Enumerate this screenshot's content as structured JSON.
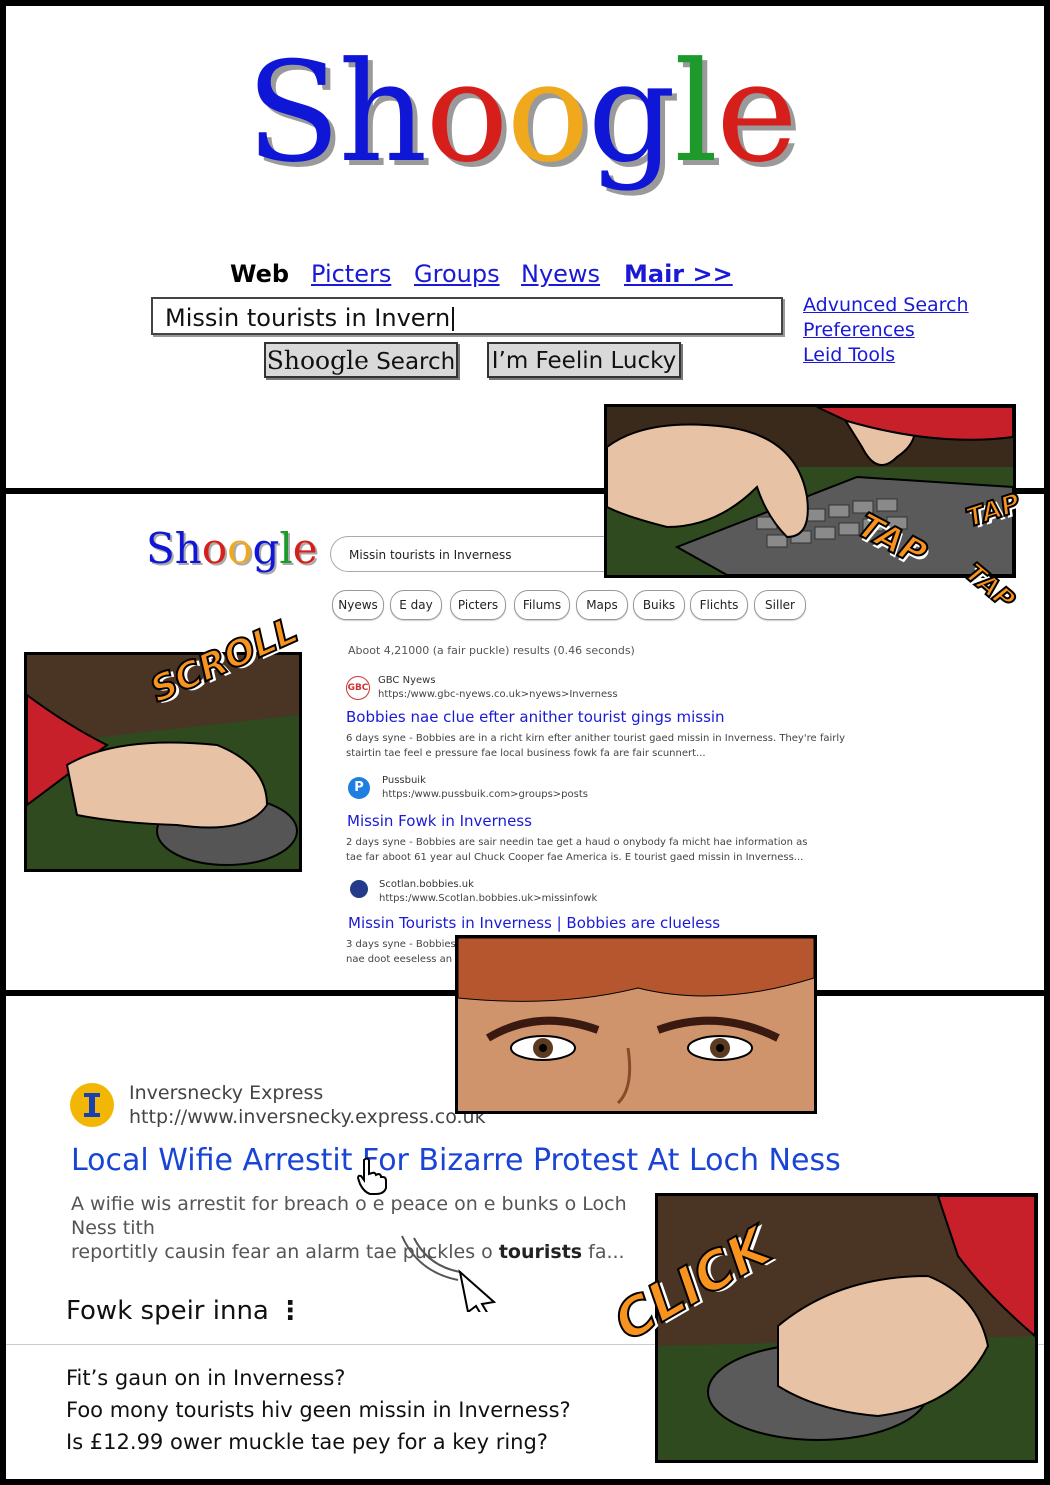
{
  "logo": {
    "letters": [
      {
        "ch": "S",
        "color": "blue"
      },
      {
        "ch": "h",
        "color": "blue"
      },
      {
        "ch": "o",
        "color": "red"
      },
      {
        "ch": "o",
        "color": "yellow"
      },
      {
        "ch": "g",
        "color": "blue"
      },
      {
        "ch": "l",
        "color": "green"
      },
      {
        "ch": "e",
        "color": "red"
      }
    ]
  },
  "nav": {
    "web": "Web",
    "picters": "Picters",
    "groups": "Groups",
    "nyews": "Nyews",
    "mair": "Mair >>"
  },
  "search": {
    "query_typing": "Missin tourists in Invern",
    "button_search_brand": "Shoogle",
    "button_search_label": "Search",
    "button_lucky": "I’m Feelin Lucky"
  },
  "side_links": {
    "advanced": "Advunced Search",
    "preferences": "Preferences",
    "tools": "Leid Tools"
  },
  "results_page": {
    "logo": "Shoogle",
    "query": "Missin tourists in Inverness",
    "chips": [
      "Nyews",
      "E day",
      "Picters",
      "Filums",
      "Maps",
      "Buiks",
      "Flichts",
      "Siller"
    ],
    "stats": "Aboot 4,21000 (a fair puckle) results (0.46 seconds)",
    "results": [
      {
        "icon_text": "GBC",
        "site": "GBC Nyews",
        "url": "https:/www.gbc-nyews.co.uk>nyews>Inverness",
        "title": "Bobbies nae clue efter anither tourist gings missin",
        "snippet1": "6 days syne - Bobbies are in a richt kirn efter anither tourist gaed missin in Inverness. They're fairly",
        "snippet2": "stairtin tae feel e pressure fae local business fowk fa are fair scunnert..."
      },
      {
        "icon_text": "P",
        "site": "Pussbuik",
        "url": "https:/www.pussbuik.com>groups>posts",
        "title": "Missin Fowk in Inverness",
        "snippet1": "2 days syne - Bobbies are sair needin tae get a haud o onybody fa micht hae information as",
        "snippet2": "tae far aboot 61 year aul Chuck Cooper fae America is. E tourist gaed missin in Inverness..."
      },
      {
        "icon_text": "",
        "site": "Scotlan.bobbies.uk",
        "url": "https:/www.Scotlan.bobbies.uk>missinfowk",
        "title": "Missin Tourists in Inverness | Bobbies are clueless",
        "snippet1": "3 days syne - Bobbies",
        "snippet2": "nae doot eeseless an"
      }
    ]
  },
  "article": {
    "site": "Inversnecky Express",
    "url": "http://www.inversnecky.express.co.uk",
    "title": "Local Wifie Arrestit For Bizarre Protest At Loch Ness",
    "snippet_line1": "A wifie wis arrestit for breach o e peace on e bunks o Loch Ness tith",
    "snippet_line2_pre": "reportitly causin fear an alarm tae puckles o ",
    "snippet_line2_bold": "tourists",
    "snippet_line2_post": " fa..."
  },
  "people_ask": {
    "heading": "Fowk speir inna",
    "questions": [
      "Fit’s gaun on in Inverness?",
      "Foo mony tourists hiv geen missin in Inverness?",
      "Is £12.99 ower muckle tae pey for a key ring?"
    ]
  },
  "sfx": {
    "tap1": "TAP",
    "tap2": "TAP",
    "tap3": "TAP",
    "scroll": "SCROLL",
    "click": "CLICK"
  },
  "colors": {
    "blue": "#1016d6",
    "red": "#d61f1a",
    "yellow": "#f0a81c",
    "green": "#1e9a2c",
    "link": "#1a1ad6",
    "sfx_orange": "#f7931e"
  }
}
